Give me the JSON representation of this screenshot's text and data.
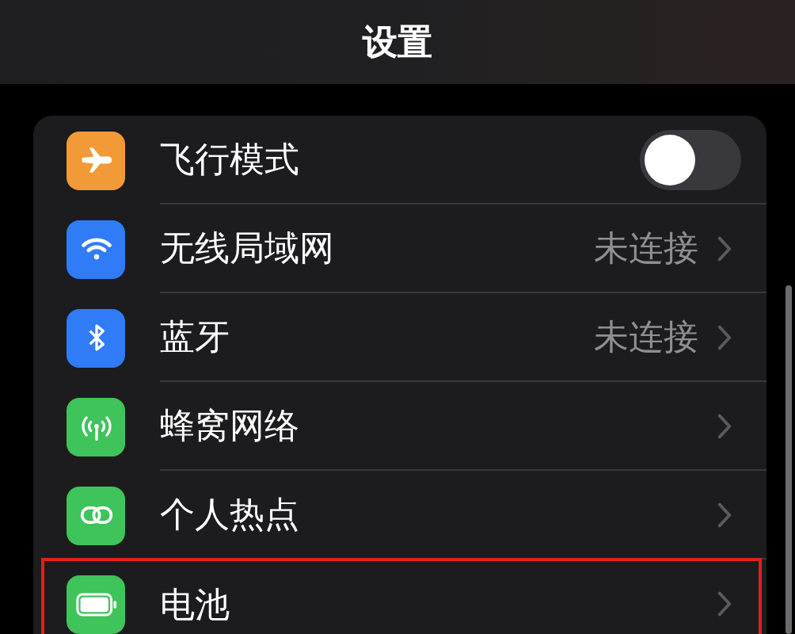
{
  "header": {
    "title": "设置"
  },
  "rows": [
    {
      "label": "飞行模式",
      "kind": "toggle",
      "on": false,
      "color": "#f19a37",
      "highlighted": false
    },
    {
      "label": "无线局域网",
      "kind": "link",
      "value": "未连接",
      "color": "#2f7cf6",
      "highlighted": false
    },
    {
      "label": "蓝牙",
      "kind": "link",
      "value": "未连接",
      "color": "#2f7cf6",
      "highlighted": false
    },
    {
      "label": "蜂窝网络",
      "kind": "link",
      "color": "#3fc35b",
      "highlighted": false
    },
    {
      "label": "个人热点",
      "kind": "link",
      "color": "#3fc35b",
      "highlighted": false
    },
    {
      "label": "电池",
      "kind": "link",
      "color": "#3fc35b",
      "highlighted": true
    }
  ]
}
